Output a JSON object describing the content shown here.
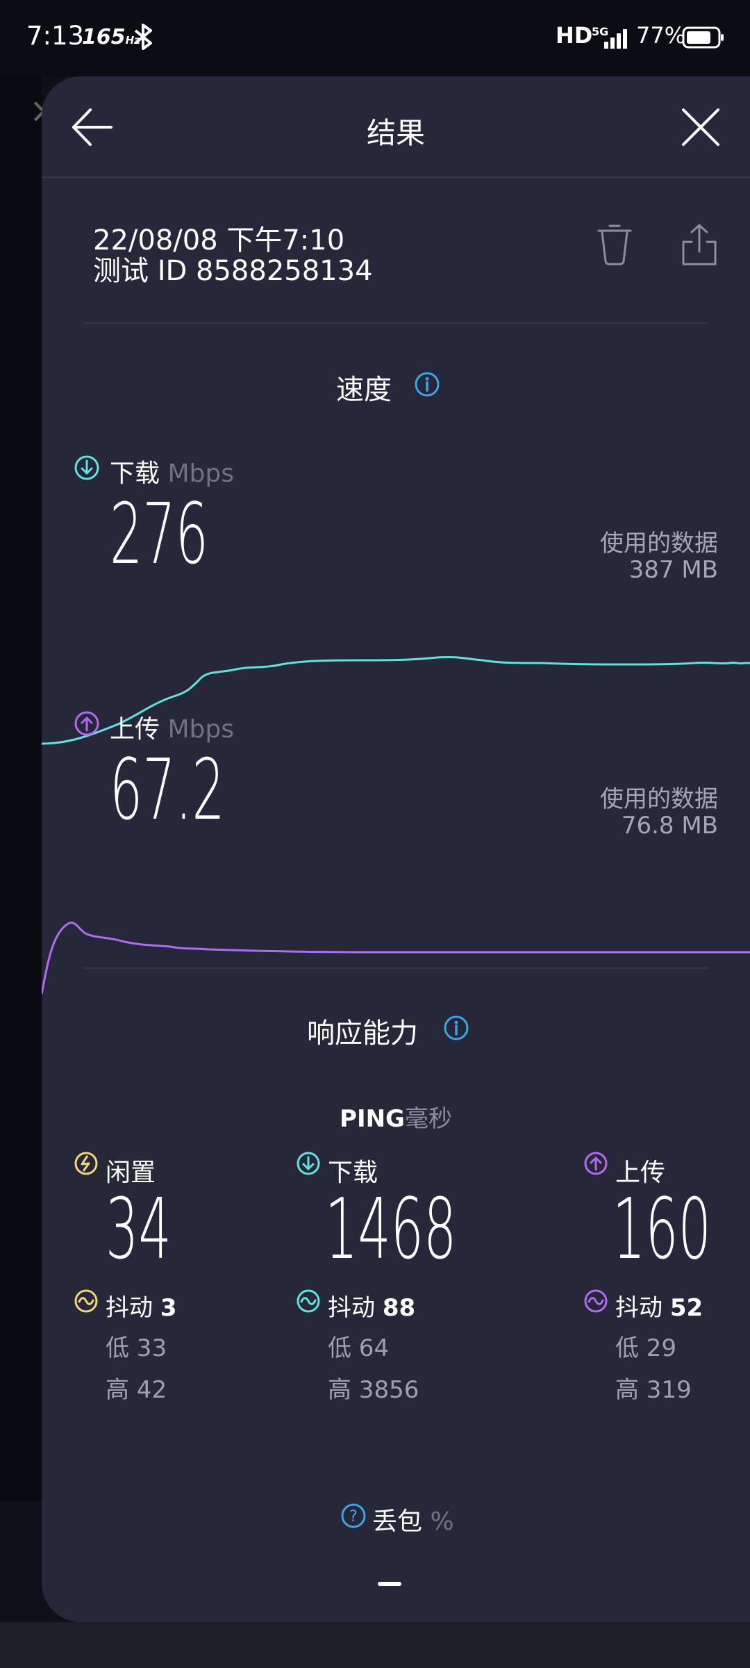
{
  "status_bar": {
    "time": "7:13",
    "refresh": "165",
    "refresh_unit": "Hz",
    "hd": "HD",
    "network": "5G",
    "battery": "77%"
  },
  "header": {
    "title": "结果",
    "back_icon": "arrow-left-icon",
    "close_icon": "close-icon"
  },
  "test": {
    "date": "22/08/08 下午7:10",
    "id_line": "测试 ID 8588258134"
  },
  "speed": {
    "title": "速度",
    "download": {
      "label": "下载",
      "unit": "Mbps",
      "value": "276",
      "data_used_label": "使用的数据",
      "data_used": "387 MB",
      "color": "#5fe3dc"
    },
    "upload": {
      "label": "上传",
      "unit": "Mbps",
      "value": "67.2",
      "data_used_label": "使用的数据",
      "data_used": "76.8 MB",
      "color": "#b06bf0"
    }
  },
  "responsiveness": {
    "title": "响应能力",
    "ping_label": "PING",
    "ping_unit": "毫秒",
    "columns": [
      {
        "label": "闲置",
        "value": "34",
        "jitter_label": "抖动",
        "jitter": "3",
        "low": "低 33",
        "high": "高 42",
        "color": "#f0d878"
      },
      {
        "label": "下载",
        "value": "1468",
        "jitter_label": "抖动",
        "jitter": "88",
        "low": "低 64",
        "high": "高 3856",
        "color": "#5fe3dc"
      },
      {
        "label": "上传",
        "value": "160",
        "jitter_label": "抖动",
        "jitter": "52",
        "low": "低 29",
        "high": "高 319",
        "color": "#b06bf0"
      }
    ]
  },
  "packet_loss": {
    "label": "丢包",
    "unit": "%"
  },
  "accent": "#3aa6e8"
}
